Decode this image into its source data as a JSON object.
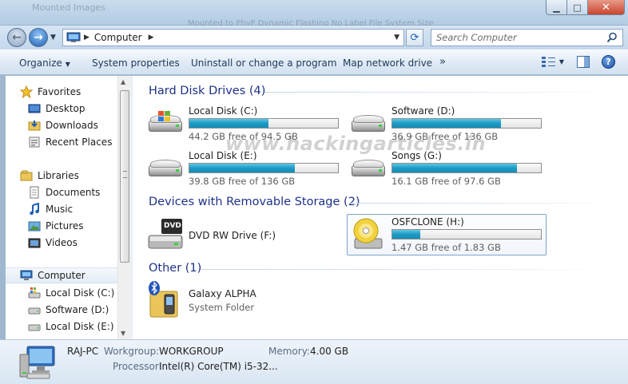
{
  "window": {
    "ghost_title": "Mounted Images",
    "ghost_headers": "Mounted to PhyP   Dynamic   Flashing   No   Label   File System   Size"
  },
  "navbar": {
    "address_path": "Computer",
    "search_placeholder": "Search Computer"
  },
  "commandbar": {
    "organize": "Organize",
    "system_properties": "System properties",
    "uninstall": "Uninstall or change a program",
    "map_drive": "Map network drive",
    "more": "»"
  },
  "sidebar": {
    "favorites": "Favorites",
    "favorites_items": [
      "Desktop",
      "Downloads",
      "Recent Places"
    ],
    "libraries": "Libraries",
    "libraries_items": [
      "Documents",
      "Music",
      "Pictures",
      "Videos"
    ],
    "computer": "Computer",
    "computer_items": [
      "Local Disk (C:)",
      "Software (D:)",
      "Local Disk (E:)"
    ]
  },
  "groups": {
    "hdd": "Hard Disk Drives (4)",
    "removable": "Devices with Removable Storage (2)",
    "other": "Other (1)"
  },
  "drives": [
    {
      "name": "Local Disk (C:)",
      "free": "44.2 GB free of 94.5 GB",
      "used_fraction": 0.53
    },
    {
      "name": "Software (D:)",
      "free": "36.9 GB free of 136 GB",
      "used_fraction": 0.73
    },
    {
      "name": "Local Disk (E:)",
      "free": "39.8 GB free of 136 GB",
      "used_fraction": 0.71
    },
    {
      "name": "Songs (G:)",
      "free": "16.1 GB free of 97.6 GB",
      "used_fraction": 0.84
    }
  ],
  "removable": [
    {
      "name": "DVD RW Drive (F:)",
      "badge": "DVD"
    },
    {
      "name": "OSFCLONE (H:)",
      "free": "1.47 GB free of 1.83 GB",
      "used_fraction": 0.19
    }
  ],
  "other": [
    {
      "name": "Galaxy ALPHA",
      "type": "System Folder"
    }
  ],
  "watermark": "www.hackingarticles.in",
  "details": {
    "pc_name": "RAJ-PC",
    "workgroup_label": "Workgroup:",
    "workgroup": "WORKGROUP",
    "memory_label": "Memory:",
    "memory": "4.00 GB",
    "processor_label": "Processor:",
    "processor": "Intel(R) Core(TM) i5-32..."
  },
  "colors": {
    "accent": "#1e3287",
    "bar_fill": "#1d9ac4"
  }
}
